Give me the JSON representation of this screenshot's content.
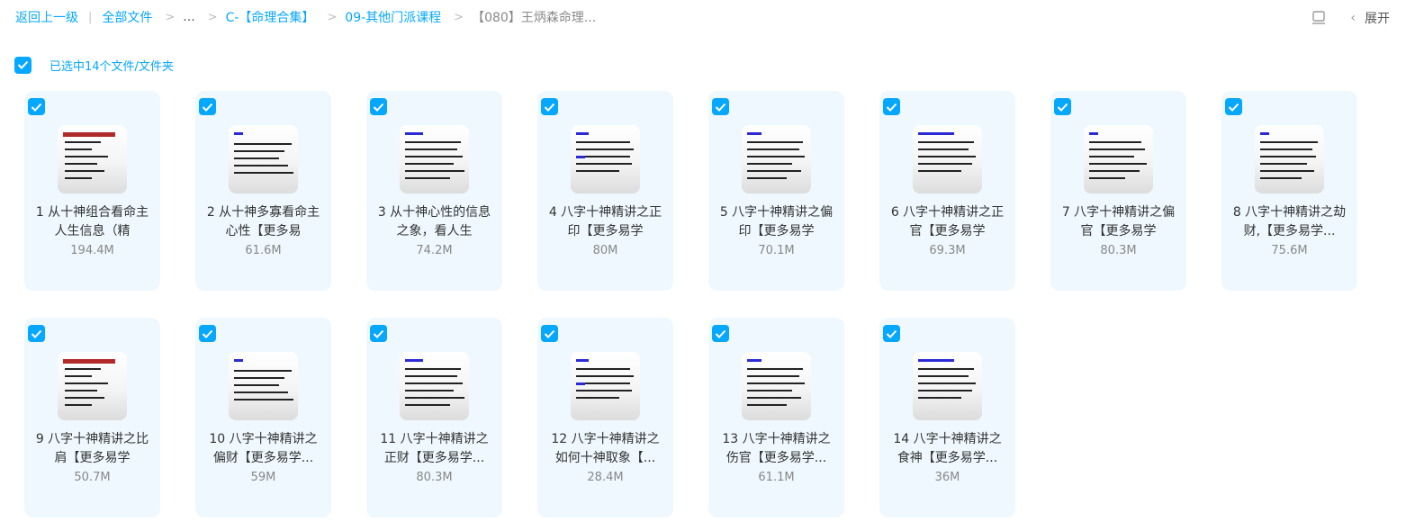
{
  "breadcrumb": {
    "back": "返回上一级",
    "items": [
      "全部文件",
      "...",
      "C-【命理合集】",
      "09-其他门派课程",
      "【080】王炳森命理..."
    ]
  },
  "toolbar": {
    "expand_label": "展开",
    "list_icon": "list-view-icon",
    "chevron_icon": "chevron-left-icon"
  },
  "selection": {
    "text": "已选中14个文件/文件夹",
    "checked": true
  },
  "colors": {
    "accent": "#06a7ff",
    "card_bg": "#eef8fe"
  },
  "files": [
    {
      "name": "1 从十神组合看命主人生信息（精",
      "size": "194.4M"
    },
    {
      "name": "2 从十神多寡看命主心性【更多易",
      "size": "61.6M"
    },
    {
      "name": "3 从十神心性的信息之象，看人生",
      "size": "74.2M"
    },
    {
      "name": "4 八字十神精讲之正印【更多易学",
      "size": "80M"
    },
    {
      "name": "5 八字十神精讲之偏印【更多易学",
      "size": "70.1M"
    },
    {
      "name": "6 八字十神精讲之正官【更多易学",
      "size": "69.3M"
    },
    {
      "name": "7 八字十神精讲之偏官【更多易学",
      "size": "80.3M"
    },
    {
      "name": "8 八字十神精讲之劫财,【更多易学...",
      "size": "75.6M"
    },
    {
      "name": "9 八字十神精讲之比肩【更多易学",
      "size": "50.7M"
    },
    {
      "name": "10 八字十神精讲之偏财【更多易学...",
      "size": "59M"
    },
    {
      "name": "11 八字十神精讲之正财【更多易学...",
      "size": "80.3M"
    },
    {
      "name": "12 八字十神精讲之如何十神取象【...",
      "size": "28.4M"
    },
    {
      "name": "13 八字十神精讲之伤官【更多易学...",
      "size": "61.1M"
    },
    {
      "name": "14 八字十神精讲之食神【更多易学...",
      "size": "36M"
    }
  ]
}
